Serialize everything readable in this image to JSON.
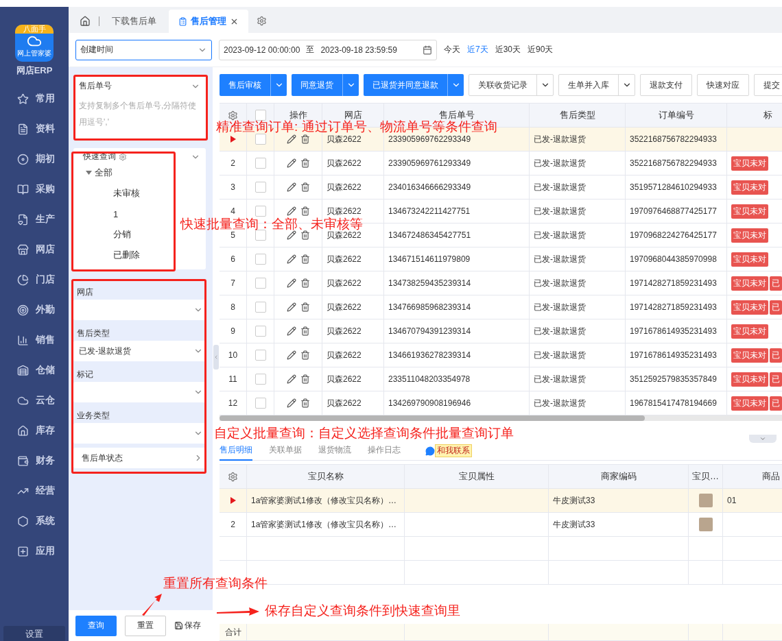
{
  "sidebar": {
    "logo_badge": "八面手",
    "logo_caption": "网上管家婆",
    "app_name": "网店ERP",
    "items": [
      {
        "label": "常用"
      },
      {
        "label": "资料"
      },
      {
        "label": "期初"
      },
      {
        "label": "采购"
      },
      {
        "label": "生产"
      },
      {
        "label": "网店"
      },
      {
        "label": "门店"
      },
      {
        "label": "外勤"
      },
      {
        "label": "销售"
      },
      {
        "label": "仓储"
      },
      {
        "label": "云仓"
      },
      {
        "label": "库存"
      },
      {
        "label": "财务"
      },
      {
        "label": "经营"
      },
      {
        "label": "系统"
      },
      {
        "label": "应用"
      }
    ],
    "settings": "设置"
  },
  "tabs": [
    {
      "label": "下载售后单",
      "selected": false
    },
    {
      "label": "售后管理",
      "selected": true
    }
  ],
  "filter": {
    "date_type": "创建时间",
    "start": "2023-09-12 00:00:00",
    "separator": "至",
    "end": "2023-09-18 23:59:59",
    "quick_ranges": [
      {
        "label": "今天",
        "selected": false
      },
      {
        "label": "近7天",
        "selected": true
      },
      {
        "label": "近30天",
        "selected": false
      },
      {
        "label": "近90天",
        "selected": false
      }
    ]
  },
  "query_panel": {
    "order_search": {
      "title": "售后单号",
      "placeholder": "支持复制多个售后单号,分隔符使用逗号','"
    },
    "quick_query": {
      "title": "快速查询",
      "tree": [
        {
          "label": "全部",
          "expanded": true,
          "children": [
            {
              "label": "未审核"
            },
            {
              "label": "1"
            },
            {
              "label": "分销"
            },
            {
              "label": "已删除"
            }
          ]
        }
      ]
    },
    "fields": [
      {
        "label": "网店"
      },
      {
        "label": "售后类型",
        "value": "已发-退款退货"
      },
      {
        "label": "标记"
      },
      {
        "label": "业务类型"
      }
    ],
    "status_link": "售后单状态",
    "buttons": [
      {
        "label": "查询",
        "kind": "primary"
      },
      {
        "label": "重置",
        "kind": "default"
      },
      {
        "label": "保存",
        "kind": "plain"
      }
    ]
  },
  "toolbar": [
    {
      "label": "售后审核",
      "kind": "primary",
      "dropdown": true
    },
    {
      "label": "同意退货",
      "kind": "primary",
      "dropdown": true
    },
    {
      "label": "已退货并同意退款",
      "kind": "primary",
      "dropdown": true
    },
    {
      "label": "关联收货记录",
      "kind": "default",
      "dropdown": true
    },
    {
      "label": "生单并入库",
      "kind": "default",
      "dropdown": true
    },
    {
      "label": "退款支付",
      "kind": "default",
      "dropdown": false
    },
    {
      "label": "快速对应",
      "kind": "default",
      "dropdown": false
    },
    {
      "label": "提交",
      "kind": "default",
      "dropdown": false
    }
  ],
  "table": {
    "select_all_checked": false,
    "columns": [
      "操作",
      "网店",
      "售后单号",
      "售后类型",
      "订单编号",
      "标"
    ],
    "rows": [
      {
        "selected": true,
        "checked": false,
        "shop": "贝森2622",
        "id": "233905969762293349",
        "type": "已发-退款退货",
        "order": "3522168756782294933",
        "tags": []
      },
      {
        "no": "2",
        "selected": false,
        "checked": false,
        "shop": "贝森2622",
        "id": "233905969761293349",
        "type": "已发-退款退货",
        "order": "3522168756782294933",
        "tags": [
          "宝贝未对"
        ]
      },
      {
        "no": "3",
        "selected": false,
        "checked": false,
        "shop": "贝森2622",
        "id": "234016346666293349",
        "type": "已发-退款退货",
        "order": "3519571284610294933",
        "tags": [
          "宝贝未对"
        ]
      },
      {
        "no": "4",
        "selected": false,
        "checked": false,
        "shop": "贝森2622",
        "id": "134673242211427751",
        "type": "已发-退款退货",
        "order": "1970976468877425177",
        "tags": [
          "宝贝未对"
        ]
      },
      {
        "no": "5",
        "selected": false,
        "checked": false,
        "shop": "贝森2622",
        "id": "134672486345427751",
        "type": "已发-退款退货",
        "order": "1970968224276425177",
        "tags": [
          "宝贝未对"
        ]
      },
      {
        "no": "6",
        "selected": false,
        "checked": false,
        "shop": "贝森2622",
        "id": "134671514611979809",
        "type": "已发-退款退货",
        "order": "1970968044385970998",
        "tags": [
          "宝贝未对"
        ]
      },
      {
        "no": "7",
        "selected": false,
        "checked": false,
        "shop": "贝森2622",
        "id": "134738259435239314",
        "type": "已发-退款退货",
        "order": "1971428271859231493",
        "tags": [
          "宝贝未对",
          "已"
        ]
      },
      {
        "no": "8",
        "selected": false,
        "checked": false,
        "shop": "贝森2622",
        "id": "134766985968239314",
        "type": "已发-退款退货",
        "order": "1971428271859231493",
        "tags": [
          "宝贝未对",
          "已"
        ]
      },
      {
        "no": "9",
        "selected": false,
        "checked": false,
        "shop": "贝森2622",
        "id": "134670794391239314",
        "type": "已发-退款退货",
        "order": "1971678614935231493",
        "tags": [
          "宝贝未对"
        ]
      },
      {
        "no": "10",
        "selected": false,
        "checked": false,
        "shop": "贝森2622",
        "id": "134661936278239314",
        "type": "已发-退款退货",
        "order": "1971678614935231493",
        "tags": [
          "宝贝未对",
          "已"
        ]
      },
      {
        "no": "11",
        "selected": false,
        "checked": false,
        "shop": "贝森2622",
        "id": "233511048203354978",
        "type": "已发-退款退货",
        "order": "3512592579835357849",
        "tags": [
          "宝贝未对",
          "已"
        ]
      },
      {
        "no": "12",
        "selected": false,
        "checked": false,
        "shop": "贝森2622",
        "id": "134269790908196946",
        "type": "已发-退款退货",
        "order": "1967815417478194669",
        "tags": [
          "宝贝未对",
          "已"
        ]
      }
    ]
  },
  "detail": {
    "tabs": [
      {
        "label": "售后明细",
        "selected": true
      },
      {
        "label": "关联单据",
        "selected": false
      },
      {
        "label": "退货物流",
        "selected": false
      },
      {
        "label": "操作日志",
        "selected": false
      }
    ],
    "contact": "和我联系",
    "columns": [
      "宝贝名称",
      "宝贝属性",
      "商家编码",
      "宝贝…",
      "商品"
    ],
    "rows": [
      {
        "selected": true,
        "name": "1a管家婆测试1修改（修改宝贝名称）…",
        "code": "牛皮测试33",
        "column_5": "01"
      },
      {
        "no": "2",
        "selected": false,
        "name": "1a管家婆测试1修改（修改宝贝名称）…",
        "code": "牛皮测试33"
      }
    ],
    "total_label": "合计"
  },
  "annotations": [
    {
      "kind": "label",
      "text": "精准查询订单: 通过订单号、物流单号等条件查询"
    },
    {
      "kind": "label",
      "text": "快速批量查询：全部、未审核等"
    },
    {
      "kind": "label",
      "text": "自定义批量查询：自定义选择查询条件批量查询订单"
    },
    {
      "kind": "label",
      "text": "重置所有查询条件"
    },
    {
      "kind": "label",
      "text": "保存自定义查询条件到快速查询里"
    }
  ]
}
